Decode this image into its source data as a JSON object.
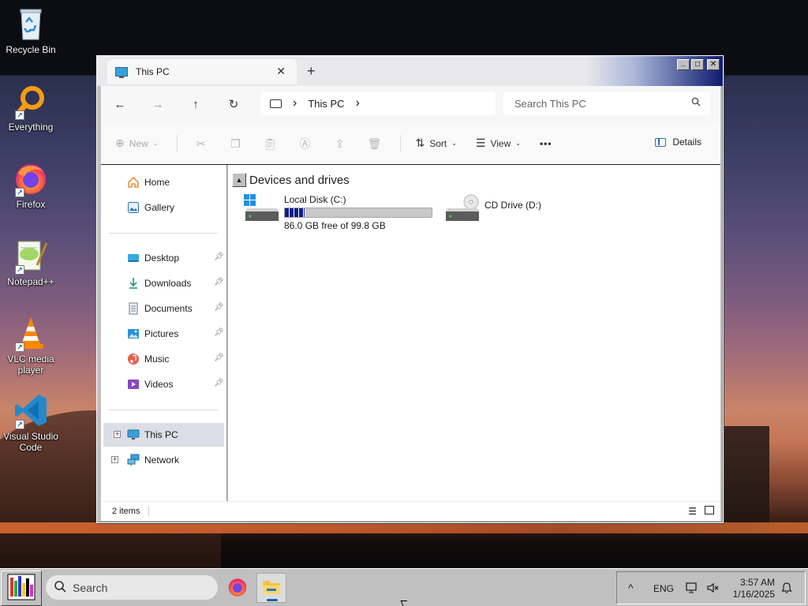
{
  "desktop": {
    "icons": [
      {
        "label": "Recycle Bin",
        "icon": "recycle-bin-icon"
      },
      {
        "label": "Everything",
        "icon": "everything-search-icon"
      },
      {
        "label": "Firefox",
        "icon": "firefox-icon"
      },
      {
        "label": "Notepad++",
        "icon": "notepad-plus-plus-icon"
      },
      {
        "label": "VLC media player",
        "icon": "vlc-icon"
      },
      {
        "label": "Visual Studio Code",
        "icon": "vscode-icon"
      }
    ]
  },
  "window": {
    "tab_title": "This PC",
    "tab_close": "✕",
    "new_tab": "+",
    "controls": {
      "minimize": "_",
      "maximize": "□",
      "close": "✕"
    }
  },
  "navbar": {
    "back": "←",
    "forward": "→",
    "up": "↑",
    "refresh": "↻",
    "breadcrumb": {
      "location": "This PC",
      "separator": "›"
    },
    "search_placeholder": "Search This PC"
  },
  "commandbar": {
    "new_label": "New",
    "sort_label": "Sort",
    "view_label": "View",
    "more_label": "•••",
    "details_label": "Details"
  },
  "sidebar": {
    "quick": [
      {
        "label": "Home",
        "icon": "home-icon"
      },
      {
        "label": "Gallery",
        "icon": "gallery-icon"
      }
    ],
    "pinned": [
      {
        "label": "Desktop",
        "icon": "desktop-folder-icon"
      },
      {
        "label": "Downloads",
        "icon": "downloads-folder-icon"
      },
      {
        "label": "Documents",
        "icon": "documents-folder-icon"
      },
      {
        "label": "Pictures",
        "icon": "pictures-folder-icon"
      },
      {
        "label": "Music",
        "icon": "music-folder-icon"
      },
      {
        "label": "Videos",
        "icon": "videos-folder-icon"
      }
    ],
    "tree": [
      {
        "label": "This PC",
        "icon": "this-pc-icon",
        "selected": true
      },
      {
        "label": "Network",
        "icon": "network-icon",
        "selected": false
      }
    ],
    "expand_glyph": "+"
  },
  "content": {
    "group_title": "Devices and drives",
    "drives": [
      {
        "label": "Local Disk (C:)",
        "free_text": "86.0 GB free of 99.8 GB",
        "used_fraction": 0.138,
        "icon": "local-disk-icon"
      },
      {
        "label": "CD Drive (D:)",
        "icon": "cd-drive-icon"
      }
    ]
  },
  "statusbar": {
    "item_count": "2 items"
  },
  "taskbar": {
    "search_placeholder": "Search",
    "tray": {
      "overflow": "^",
      "language": "ENG",
      "time": "3:57 AM",
      "date": "1/16/2025"
    }
  },
  "colors": {
    "selection": "#dcdde6",
    "titlebar_gradient_end": "#0d1b6e",
    "drive_bar_fill": "#0c1d86"
  }
}
